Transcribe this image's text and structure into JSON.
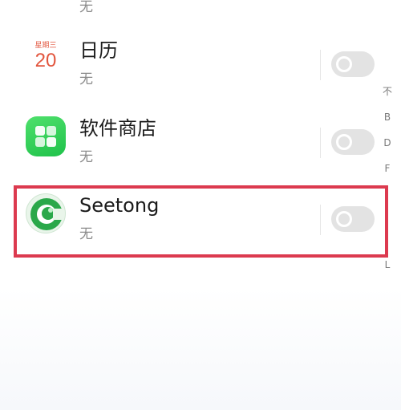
{
  "top_partial": {
    "subtitle": "无"
  },
  "apps": [
    {
      "name": "日历",
      "subtitle": "无",
      "icon": "calendar-icon",
      "icon_week": "星期三",
      "icon_day": "20"
    },
    {
      "name": "软件商店",
      "subtitle": "无",
      "icon": "app-store-icon"
    },
    {
      "name": "Seetong",
      "subtitle": "无",
      "icon": "seetong-icon"
    }
  ],
  "toggles": [
    "off",
    "off",
    "off"
  ],
  "index_bar": {
    "items": [
      "不",
      "B",
      "D",
      "F",
      "",
      "",
      "L"
    ]
  },
  "colors": {
    "highlight": "#dc3a4f",
    "store_green": "#2fcf58",
    "seetong_green": "#2aa84a"
  }
}
